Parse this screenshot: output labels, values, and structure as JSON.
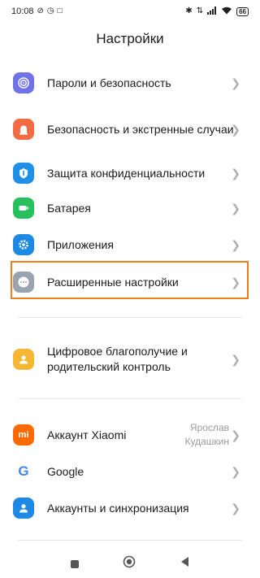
{
  "status_bar": {
    "time": "10:08",
    "battery": "66"
  },
  "header": {
    "title": "Настройки"
  },
  "items": [
    {
      "label": "Пароли и безопасность",
      "icon": "fingerprint-icon",
      "color": "#6f72e8"
    },
    {
      "label": "Безопасность и экстренные случаи",
      "icon": "emergency-icon",
      "color": "#f26b43"
    },
    {
      "label": "Защита конфиденциальности",
      "icon": "privacy-icon",
      "color": "#1f8fe8"
    },
    {
      "label": "Батарея",
      "icon": "battery-icon",
      "color": "#27c05c"
    },
    {
      "label": "Приложения",
      "icon": "gear-icon",
      "color": "#1e88e5"
    },
    {
      "label": "Расширенные настройки",
      "icon": "more-icon",
      "color": "#9aa3b0"
    },
    {
      "label": "Цифровое благополучие и родительский контроль",
      "icon": "wellbeing-icon",
      "color": "#f4b731"
    },
    {
      "label": "Аккаунт Xiaomi",
      "icon": "xiaomi-icon",
      "color": "#ff6a00",
      "value": "Ярослав Кудашкин"
    },
    {
      "label": "Google",
      "icon": "google-icon",
      "color": "#ffffff"
    },
    {
      "label": "Аккаунты и синхронизация",
      "icon": "accounts-icon",
      "color": "#1e88e5"
    }
  ],
  "icon_glyphs": {
    "xiaomi": "mi",
    "google": "G"
  },
  "highlight_color": "#ef7d1a"
}
